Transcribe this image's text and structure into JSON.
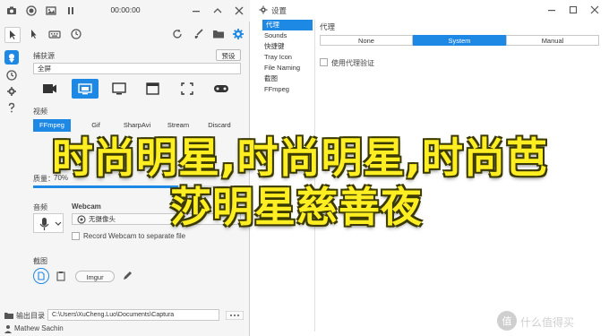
{
  "left_window": {
    "title": "00:00:00",
    "sidebar_active_color": "#1e88e5",
    "sections": {
      "preset_label": "捕获源",
      "preset_button": "预设",
      "preset_value": "全屏",
      "formats": [
        "FFmpeg",
        "Gif",
        "SharpAvi",
        "Stream",
        "Discard"
      ],
      "format_active": "FFmpeg",
      "quality_label": "质量：",
      "quality_value": "70%",
      "audio_label": "音频",
      "webcam_label": "Webcam",
      "webcam_select": "无摄像头",
      "webcam_checkbox": "Record Webcam to separate file",
      "image_label": "截图",
      "imgur_button": "Imgur"
    },
    "status": {
      "output_label": "输出目录",
      "output_path": "C:\\Users\\XuCheng.Luo\\Documents\\Captura",
      "author": "Mathew Sachin"
    }
  },
  "right_window": {
    "title": "设置",
    "nav_items": [
      "代理",
      "Sounds",
      "快捷键",
      "Tray Icon",
      "File Naming",
      "截图",
      "FFmpeg"
    ],
    "nav_selected": "代理",
    "section_title": "代理",
    "proxy_options": [
      "None",
      "System",
      "Manual"
    ],
    "proxy_selected": "System",
    "auth_checkbox": "使用代理验证"
  },
  "banner": {
    "line1": "时尚明星,时尚明星,时尚芭",
    "line2": "莎明星慈善夜"
  },
  "watermark": {
    "text": "值 什么值得买"
  }
}
